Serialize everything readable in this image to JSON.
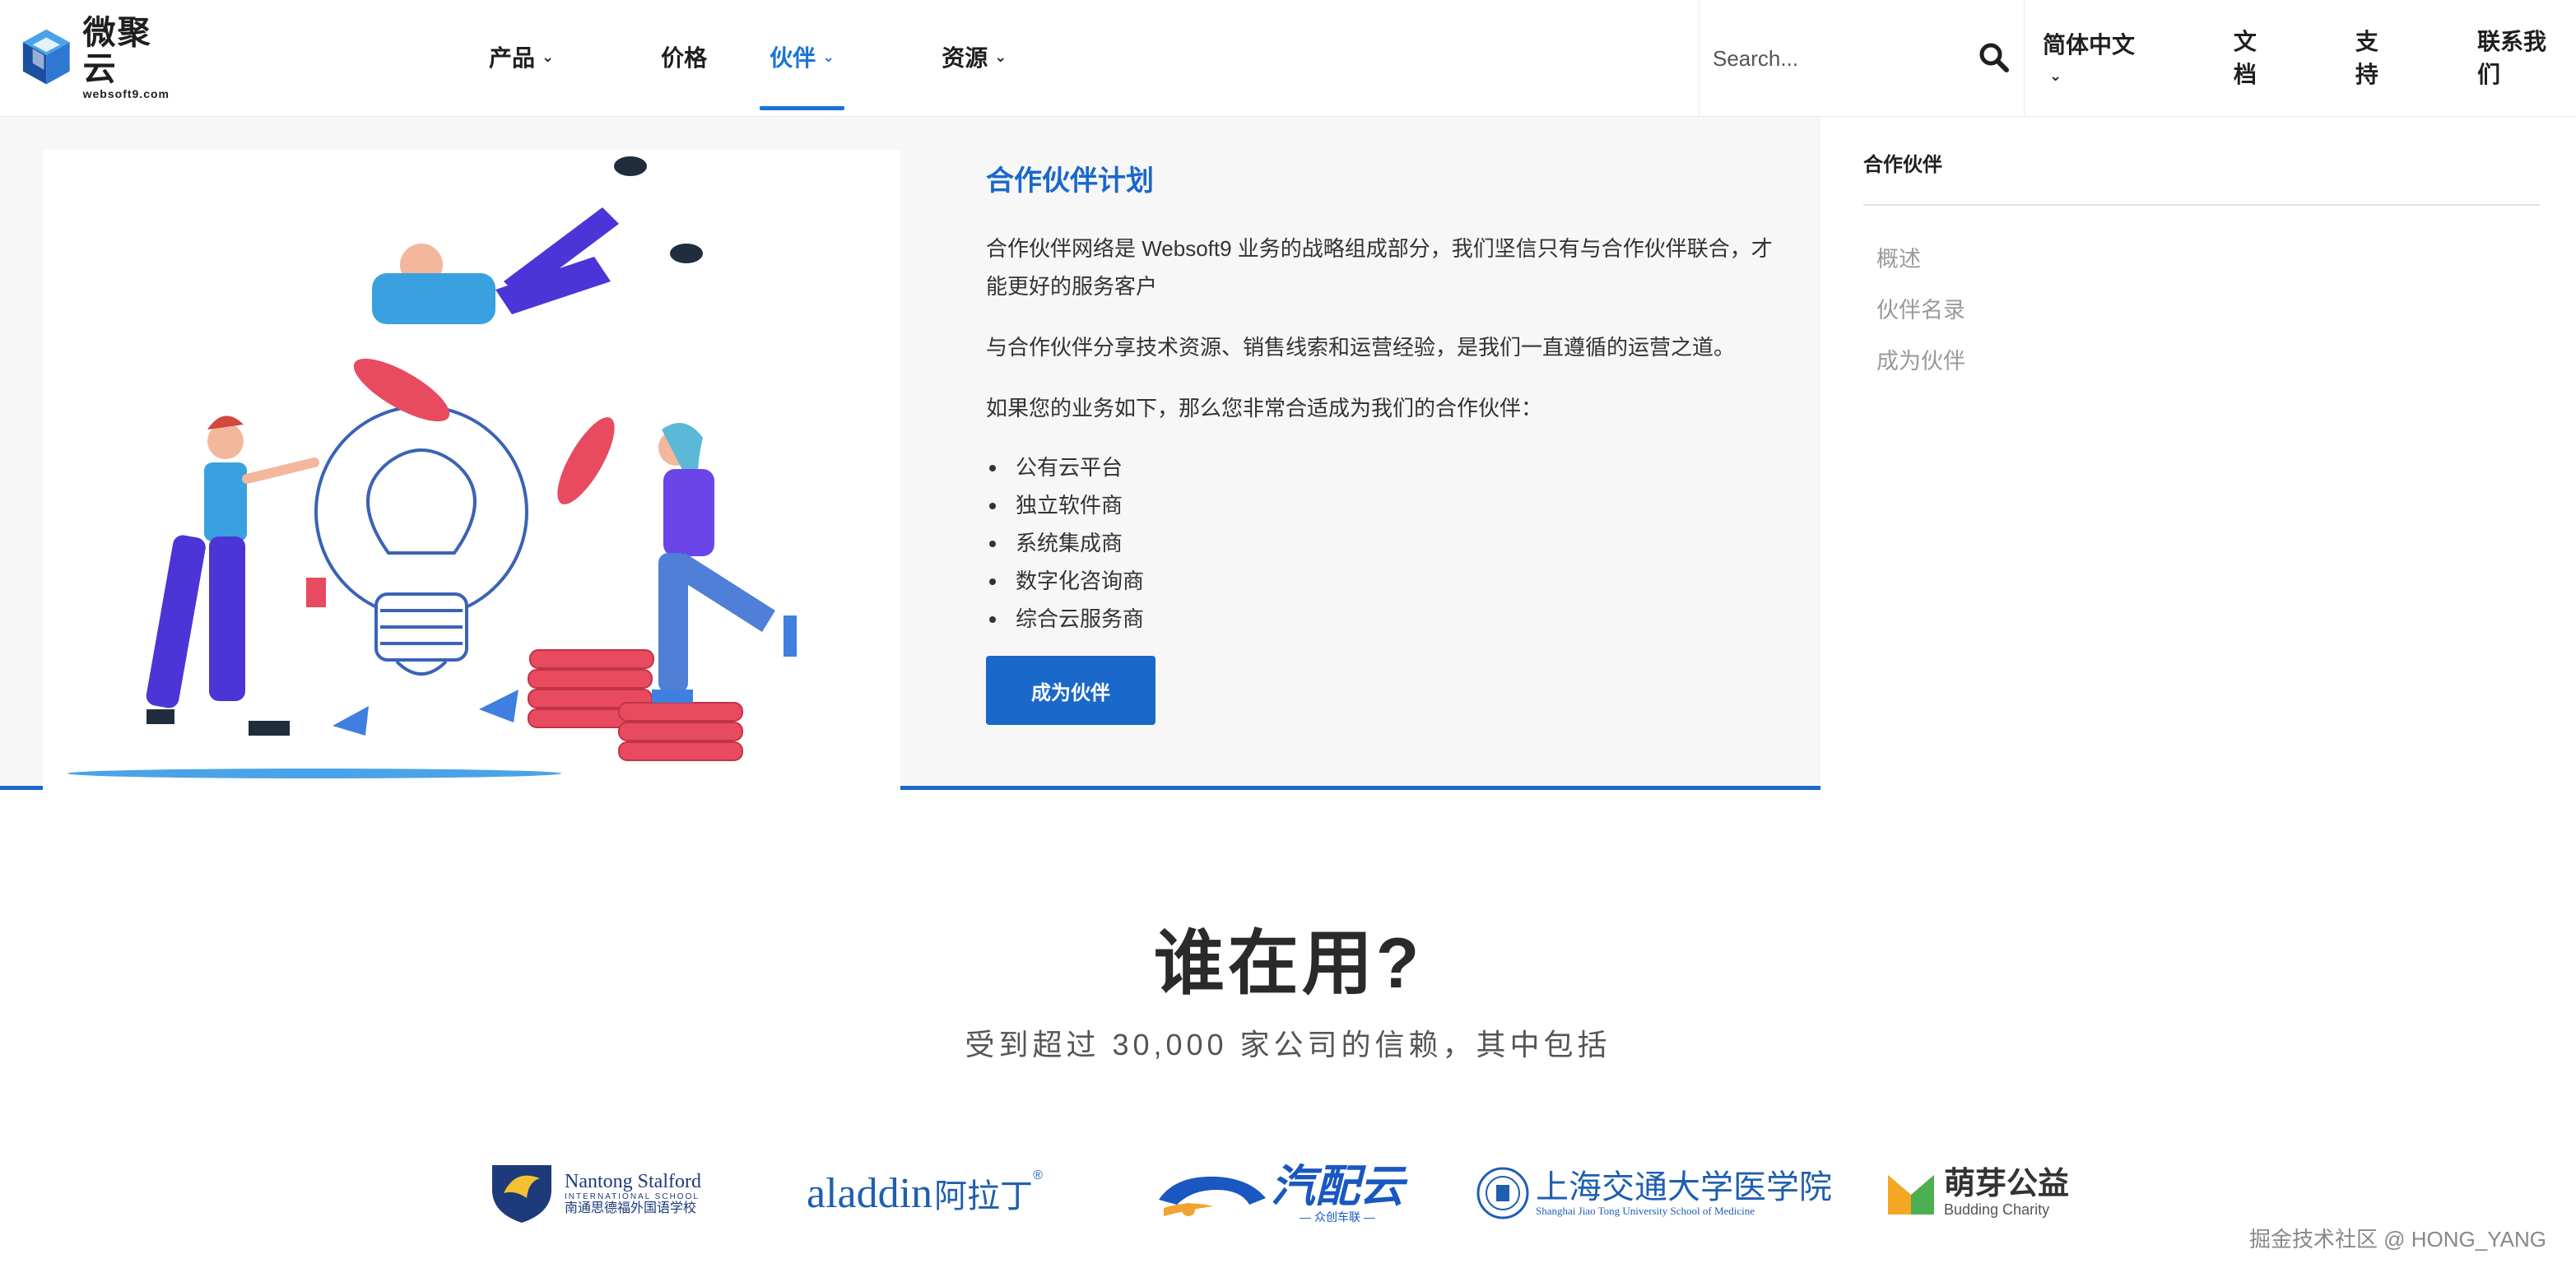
{
  "brand": {
    "name_cn": "微聚云",
    "domain": "websoft9.com"
  },
  "nav": {
    "items": [
      {
        "label": "产品",
        "has_dropdown": true,
        "active": false
      },
      {
        "label": "价格",
        "has_dropdown": false,
        "active": false
      },
      {
        "label": "伙伴",
        "has_dropdown": true,
        "active": true
      },
      {
        "label": "资源",
        "has_dropdown": true,
        "active": false
      }
    ]
  },
  "search": {
    "placeholder": "Search..."
  },
  "right_nav": {
    "language": "简体中文",
    "docs": "文档",
    "support": "支持",
    "contact": "联系我们"
  },
  "dropdown": {
    "heading": "合作伙伴计划",
    "para1": "合作伙伴网络是 Websoft9 业务的战略组成部分，我们坚信只有与合作伙伴联合，才能更好的服务客户",
    "para2": "与合作伙伴分享技术资源、销售线索和运营经验，是我们一直遵循的运营之道。",
    "para3": "如果您的业务如下，那么您非常合适成为我们的合作伙伴：",
    "list": [
      "公有云平台",
      "独立软件商",
      "系统集成商",
      "数字化咨询商",
      "综合云服务商"
    ],
    "cta": "成为伙伴",
    "side": {
      "title": "合作伙伴",
      "links": [
        "概述",
        "伙伴名录",
        "成为伙伴"
      ]
    }
  },
  "who": {
    "title": "谁在用?",
    "subtitle": "受到超过 30,000 家公司的信赖，其中包括"
  },
  "partners": {
    "nantong": {
      "line1": "Nantong Stalford",
      "line2": "INTERNATIONAL SCHOOL",
      "line3": "南通思德福外国语学校"
    },
    "aladdin": {
      "text": "aladdin",
      "cn": "阿拉丁",
      "mark": "®"
    },
    "qipei": {
      "cn": "汽配云",
      "sub": "— 众创车联 —"
    },
    "sjtu": {
      "cn": "上海交通大学医学院",
      "en": "Shanghai Jiao Tong University School of Medicine"
    },
    "budding": {
      "cn": "萌芽公益",
      "en": "Budding Charity"
    }
  },
  "watermark": "掘金技术社区 @ HONG_YANG",
  "colors": {
    "accent": "#1a68c9",
    "nav_active": "#1a73d9",
    "panel_bg": "#f7f7f7"
  }
}
